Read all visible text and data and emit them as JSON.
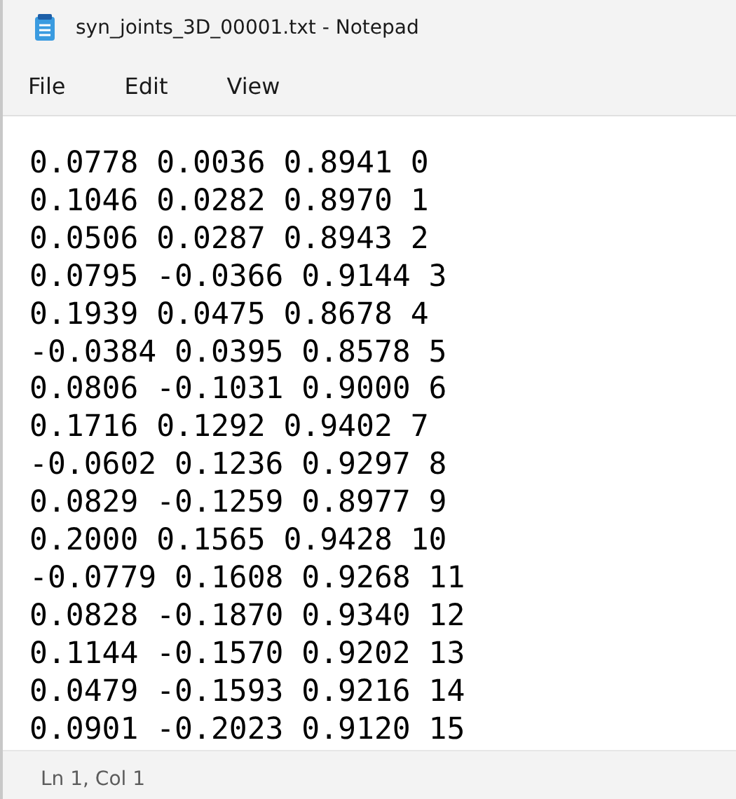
{
  "window": {
    "title": "syn_joints_3D_00001.txt - Notepad"
  },
  "menu": [
    "File",
    "Edit",
    "View"
  ],
  "lines": [
    "0.0778 0.0036 0.8941 0",
    "0.1046 0.0282 0.8970 1",
    "0.0506 0.0287 0.8943 2",
    "0.0795 -0.0366 0.9144 3",
    "0.1939 0.0475 0.8678 4",
    "-0.0384 0.0395 0.8578 5",
    "0.0806 -0.1031 0.9000 6",
    "0.1716 0.1292 0.9402 7",
    "-0.0602 0.1236 0.9297 8",
    "0.0829 -0.1259 0.8977 9",
    "0.2000 0.1565 0.9428 10",
    "-0.0779 0.1608 0.9268 11",
    "0.0828 -0.1870 0.9340 12",
    "0.1144 -0.1570 0.9202 13",
    "0.0479 -0.1593 0.9216 14",
    "0.0901 -0.2023 0.9120 15"
  ],
  "status_bar": {
    "position": "Ln 1, Col 1"
  }
}
